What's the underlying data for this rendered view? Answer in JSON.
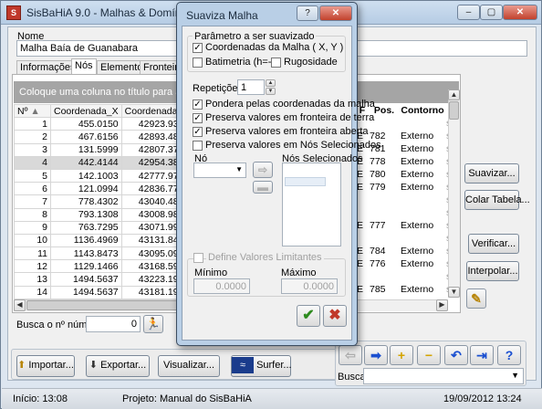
{
  "app": {
    "title": "SisBaHiA 9.0 - Malhas & Domínios de Mo",
    "icon_letter": "S",
    "window_buttons": [
      "–",
      "▢",
      "✕"
    ]
  },
  "main": {
    "name_label": "Nome",
    "name_value": "Malha Baía de Guanabara",
    "tabs": [
      "Informações",
      "Nós",
      "Elementos",
      "Fronteiras"
    ],
    "group_hint": "Coloque uma coluna no título para agrupar o",
    "columns": [
      "Nº",
      "Coordenada_X",
      "Coordenada_Y"
    ],
    "right_columns": [
      "F",
      "Pos.",
      "Contorno"
    ],
    "rows": [
      {
        "n": "1",
        "x": "455.0150",
        "y": "42923.9330",
        "f": "",
        "pos": "",
        "contorno": ""
      },
      {
        "n": "2",
        "x": "467.6156",
        "y": "42893.4815",
        "f": "E",
        "pos": "782",
        "contorno": "Externo"
      },
      {
        "n": "3",
        "x": "131.5999",
        "y": "42807.3779",
        "f": "E",
        "pos": "781",
        "contorno": "Externo"
      },
      {
        "n": "4",
        "x": "442.4144",
        "y": "42954.3845",
        "f": "E",
        "pos": "778",
        "contorno": "Externo"
      },
      {
        "n": "5",
        "x": "142.1003",
        "y": "42777.9760",
        "f": "E",
        "pos": "780",
        "contorno": "Externo"
      },
      {
        "n": "6",
        "x": "121.0994",
        "y": "42836.7790",
        "f": "E",
        "pos": "779",
        "contorno": "Externo"
      },
      {
        "n": "7",
        "x": "778.4302",
        "y": "43040.4885",
        "f": "",
        "pos": "",
        "contorno": ""
      },
      {
        "n": "8",
        "x": "793.1308",
        "y": "43008.9870",
        "f": "",
        "pos": "",
        "contorno": ""
      },
      {
        "n": "9",
        "x": "763.7295",
        "y": "43071.9900",
        "f": "E",
        "pos": "777",
        "contorno": "Externo"
      },
      {
        "n": "10",
        "x": "1136.4969",
        "y": "43131.8427",
        "f": "",
        "pos": "",
        "contorno": ""
      },
      {
        "n": "11",
        "x": "1143.8473",
        "y": "43095.0910",
        "f": "E",
        "pos": "784",
        "contorno": "Externo"
      },
      {
        "n": "12",
        "x": "1129.1466",
        "y": "43168.5945",
        "f": "E",
        "pos": "776",
        "contorno": "Externo"
      },
      {
        "n": "13",
        "x": "1494.5637",
        "y": "43223.1970",
        "f": "",
        "pos": "",
        "contorno": ""
      },
      {
        "n": "14",
        "x": "1494.5637",
        "y": "43181.1950",
        "f": "E",
        "pos": "785",
        "contorno": "Externo"
      }
    ],
    "selected_row_index": 3,
    "right_col_letters": [
      "s",
      "s",
      "s",
      "s",
      "s",
      "s",
      "s",
      "s",
      "s",
      "s",
      "s",
      "s",
      "s",
      "s"
    ],
    "search_number_label": "Busca o nº número:",
    "search_number_value": "0",
    "side_buttons": [
      "Suavizar...",
      "Colar Tabela...",
      "Verificar...",
      "Interpolar..."
    ],
    "bottom_buttons": [
      "Importar...",
      "Exportar...",
      "Visualizar...",
      "Surfer..."
    ],
    "busca_label": "Busca:",
    "busca_value": ""
  },
  "status": {
    "inicio": "Início: 13:08",
    "projeto": "Projeto: Manual do SisBaHiA",
    "datetime": "19/09/2012 13:24"
  },
  "dialog": {
    "title": "Suaviza Malha",
    "help": "?",
    "close": "✕",
    "param_group": "Parâmetro a ser suavizado",
    "coord_label": "Coordenadas da Malha ( X, Y )",
    "coord_checked": true,
    "batimetria_label": "Batimetria (h=-Z)",
    "batimetria_checked": false,
    "rugosidade_label": "Rugosidade",
    "rugosidade_checked": false,
    "repeticoes_label": "Repetições:",
    "repeticoes_value": "1",
    "pondera_label": "Pondera pelas coordenadas da malha",
    "pondera_checked": true,
    "preserva_terra_label": "Preserva valores em fronteira de terra",
    "preserva_terra_checked": true,
    "preserva_aberta_label": "Preserva valores em fronteira aberta",
    "preserva_aberta_checked": true,
    "preserva_nos_label": "Preserva valores em Nós Selecionados",
    "preserva_nos_checked": false,
    "no_label": "Nó",
    "nos_sel_label": "Nós Selecionados",
    "define_label": "Define Valores Limitantes",
    "define_checked": false,
    "minimo_label": "Mínimo",
    "minimo_value": "0.0000",
    "maximo_label": "Máximo",
    "maximo_value": "0.0000",
    "ok_glyph": "✔",
    "cancel_glyph": "✖"
  },
  "colors": {
    "accent_ok": "#2e8b1f",
    "accent_cancel": "#c0392b",
    "nav_arrow": "#1a4fd0"
  }
}
